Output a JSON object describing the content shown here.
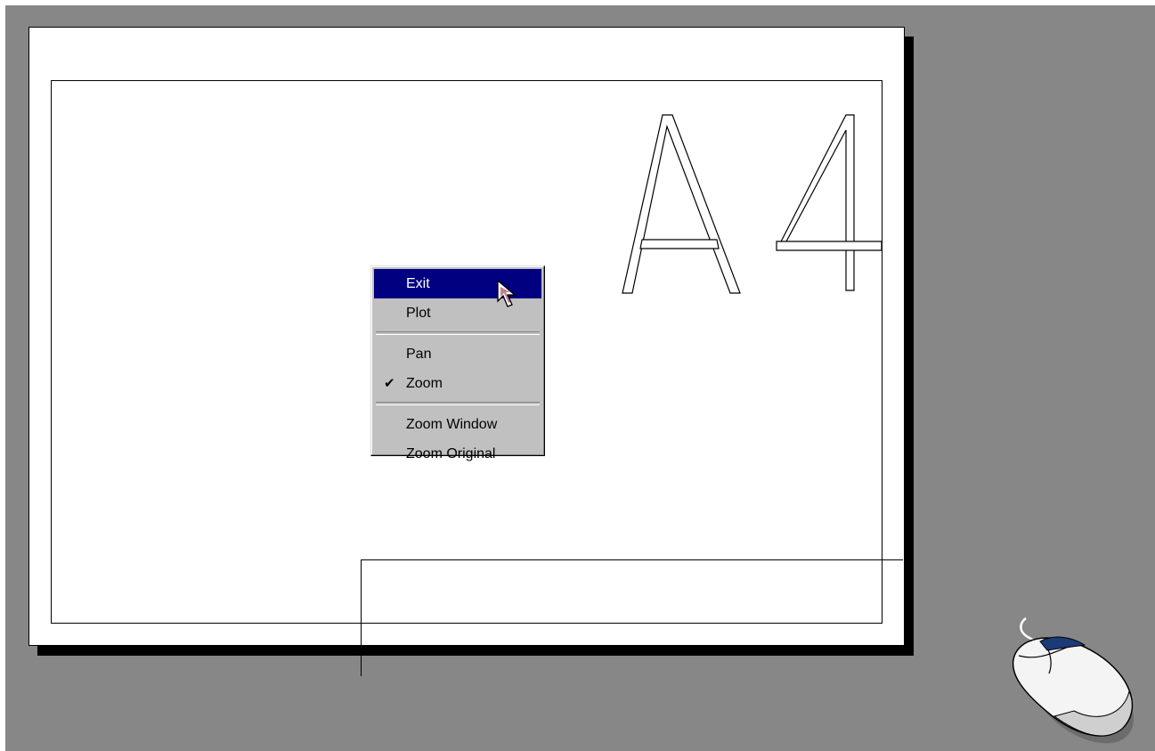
{
  "context_menu": {
    "items": [
      {
        "label": "Exit",
        "highlighted": true,
        "checked": false
      },
      {
        "label": "Plot",
        "highlighted": false,
        "checked": false
      },
      {
        "label": "Pan",
        "highlighted": false,
        "checked": false
      },
      {
        "label": "Zoom",
        "highlighted": false,
        "checked": true
      },
      {
        "label": "Zoom Window",
        "highlighted": false,
        "checked": false
      },
      {
        "label": "Zoom Original",
        "highlighted": false,
        "checked": false
      }
    ],
    "check_glyph": "✔"
  },
  "drawing": {
    "sheet_label": "A4"
  },
  "icons": {
    "cursor": "arrow-cursor-icon",
    "mouse": "computer-mouse-icon"
  },
  "colors": {
    "background": "#878787",
    "sheet": "#ffffff",
    "menu_background": "#c0c0c0",
    "menu_highlight": "#000080",
    "cursor_accent": "#8b1a3a",
    "mouse_accent": "#1c3a78"
  }
}
